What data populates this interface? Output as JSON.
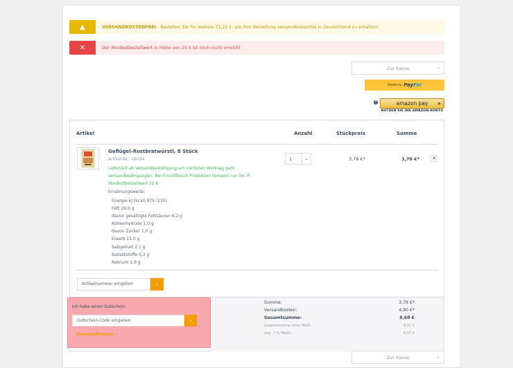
{
  "alerts": {
    "shipping_icon": "warning-icon",
    "shipping_strong": "VERSANDKOSTENFREI",
    "shipping_text": " - Bestellen Sie für weitere 71,22 €, um Ihre Bestellung versandkostenfrei in Deutschland zu erhalten!",
    "minorder_icon": "close-icon",
    "minorder_text": "Der Mindestbestellwert in Höhe von 25 € ist noch nicht erreicht"
  },
  "buttons": {
    "checkout_top": "Zur Kasse",
    "checkout_bottom": "Zur Kasse",
    "paypal_prefix": "Direkt zu",
    "paypal_brand1": "Pay",
    "paypal_brand2": "Pal",
    "amazon_label": "amazon pay",
    "amazon_sub": "NUTZEN SIE IHR AMAZON-KONTO"
  },
  "table": {
    "headers": [
      "Artikel",
      "Anzahl",
      "Stückpreis",
      "Summe"
    ]
  },
  "item": {
    "name": "Geflügel-Rostbratwürstl, 8 Stück",
    "article_no": "Artikel-Nr.: 08084",
    "delivery_lines": [
      "Lieferzeit ab Versandbestätigung am nächsten Werktag gem.",
      "Versandbedingungen. Bei Frischfleisch Produkten Versand nur Do.-Fr.",
      "Mindestbestellwert 25 €"
    ],
    "nutrition_title": "Ernährungswerte:",
    "nutrition": [
      "Energie kJ (kcal) 975 (235)",
      "Fett 19,0 g",
      "davon gesättigte Fettsäuren 6,2 g",
      "Kohlenhydrate 1,0 g",
      "davon Zucker 1,0 g",
      "Eiweiß 15,0 g",
      "Salzgehalt 2,1 g",
      "Ballaststoffe 0,3 g",
      "Natrium 1,0 g"
    ],
    "quantity": "1",
    "unit_price": "3,78 €*",
    "total": "3,78 €*"
  },
  "add_article": {
    "placeholder": "Artikelnummer eingeben"
  },
  "voucher": {
    "label": "Ich habe einen Gutschein",
    "placeholder": "Gutschein-Code eingeben",
    "shipping_link": "Versandkosten ›"
  },
  "totals": [
    {
      "label": "Summe:",
      "value": "3,78 €*",
      "style": "normal"
    },
    {
      "label": "Versandkosten:",
      "value": "4,90 €*",
      "style": "normal"
    },
    {
      "label": "Gesamtsumme:",
      "value": "8,68 €",
      "style": "bold"
    },
    {
      "label": "Gesamtsumme ohne MwSt.:",
      "value": "8,11 €",
      "style": "small"
    },
    {
      "label": "zzgl. 7 % MwSt.:",
      "value": "0,57 €",
      "style": "small"
    }
  ],
  "colors": {
    "accent": "#f59c00",
    "success": "#3cba54",
    "error": "#e64545",
    "warning": "#e6b800"
  }
}
